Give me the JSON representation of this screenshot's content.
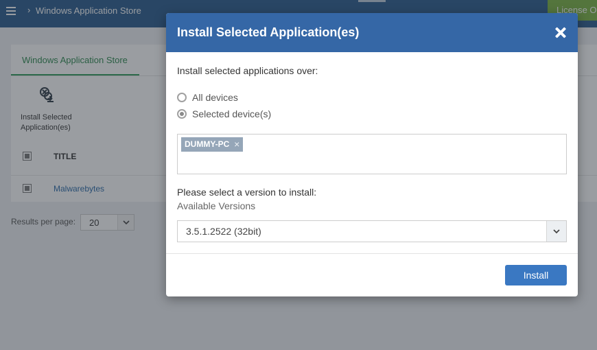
{
  "app": {
    "breadcrumb_sep": "›",
    "breadcrumb": "Windows Application Store",
    "license_button": "License Options"
  },
  "store": {
    "tab_label": "Windows Application Store",
    "toolbar": {
      "install_label": "Install Selected\nApplication(es)",
      "install_icon": "install-app-icon"
    },
    "table": {
      "columns": [
        "TITLE"
      ],
      "rows": [
        {
          "title": "Malwarebytes",
          "selected": true
        }
      ]
    },
    "pagination": {
      "label": "Results per page:",
      "value": "20"
    }
  },
  "dialog": {
    "title": "Install Selected Application(es)",
    "close_icon": "close-icon",
    "intro": "Install selected applications over:",
    "target_options": [
      {
        "label": "All devices",
        "checked": false
      },
      {
        "label": "Selected device(s)",
        "checked": true
      }
    ],
    "selected_devices": [
      {
        "name": "DUMMY-PC",
        "remove_glyph": "×"
      }
    ],
    "version_prompt": "Please select a version to install:",
    "version_sublabel": "Available Versions",
    "version_value": "3.5.1.2522 (32bit)",
    "install_button": "Install"
  },
  "colors": {
    "header": "#3567a6",
    "topbar": "#2a5c8f",
    "primary_button": "#3a78c2",
    "tab_accent": "#2e9b5a",
    "license_button": "#7cb342",
    "device_tag": "#95a6b8"
  }
}
